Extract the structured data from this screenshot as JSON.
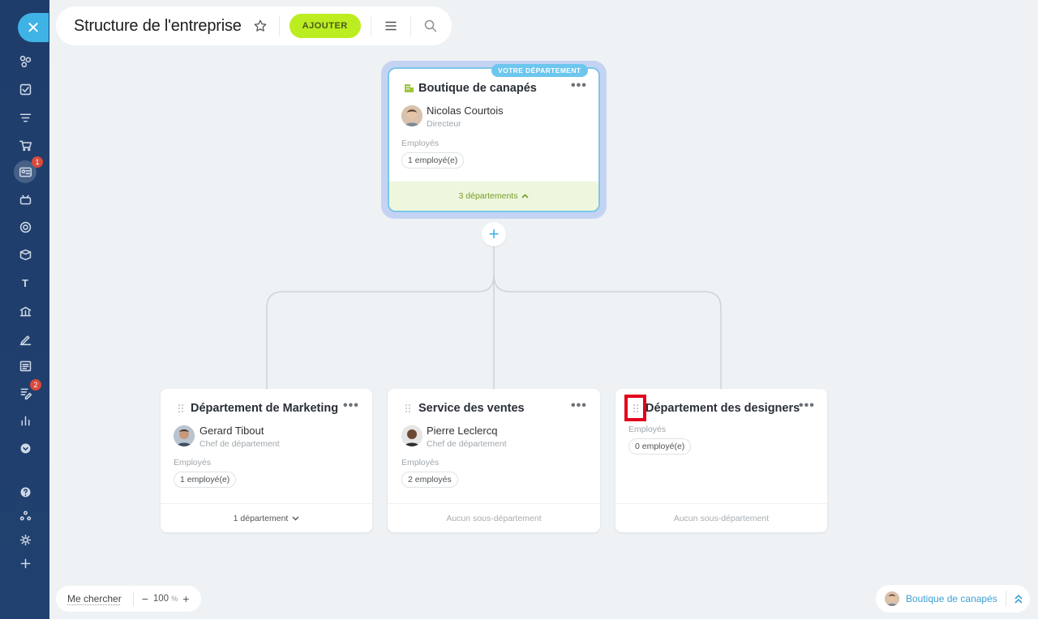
{
  "header": {
    "title": "Structure de l'entreprise",
    "add_label": "AJOUTER"
  },
  "sidebar": {
    "items": [
      {
        "icon": "sitemap-icon"
      },
      {
        "icon": "task-icon"
      },
      {
        "icon": "filter-icon"
      },
      {
        "icon": "cart-icon"
      },
      {
        "icon": "contact-card-icon",
        "badge": "1"
      },
      {
        "icon": "robot-icon"
      },
      {
        "icon": "target-icon"
      },
      {
        "icon": "box-icon"
      },
      {
        "icon": "text-icon",
        "glyph": "T"
      },
      {
        "icon": "bank-icon"
      },
      {
        "icon": "sign-icon"
      },
      {
        "icon": "list-check-icon"
      },
      {
        "icon": "edit-list-icon",
        "badge": "2"
      },
      {
        "icon": "bar-chart-icon"
      },
      {
        "icon": "chevron-circle-icon"
      },
      {
        "icon": "help-icon"
      },
      {
        "icon": "structure-icon"
      },
      {
        "icon": "settings-icon"
      },
      {
        "icon": "plus-icon"
      }
    ]
  },
  "root": {
    "badge": "VOTRE DÉPARTEMENT",
    "name": "Boutique de canapés",
    "head_name": "Nicolas Courtois",
    "head_role": "Directeur",
    "employees_label": "Employés",
    "employees_count": "1 employé(e)",
    "footer": "3 départements"
  },
  "departments": [
    {
      "name": "Département de Marketing",
      "head_name": "Gerard Tibout",
      "head_role": "Chef de département",
      "employees_label": "Employés",
      "employees_count": "1 employé(e)",
      "footer": "1 département"
    },
    {
      "name": "Service des ventes",
      "head_name": "Pierre Leclercq",
      "head_role": "Chef de département",
      "employees_label": "Employés",
      "employees_count": "2 employés",
      "footer": "Aucun sous-département"
    },
    {
      "name": "Département des designers",
      "employees_label": "Employés",
      "employees_count": "0 employé(e)",
      "footer": "Aucun sous-département"
    }
  ],
  "controls": {
    "find_me": "Me chercher",
    "zoom_value": "100",
    "zoom_unit": "%",
    "current_department": "Boutique de canapés"
  },
  "colors": {
    "sidebar": "#1f3d6b",
    "accent": "#3fb3e6",
    "add_button": "#bbed21",
    "root_badge": "#6cc6ee",
    "highlight": "#e3001b"
  }
}
